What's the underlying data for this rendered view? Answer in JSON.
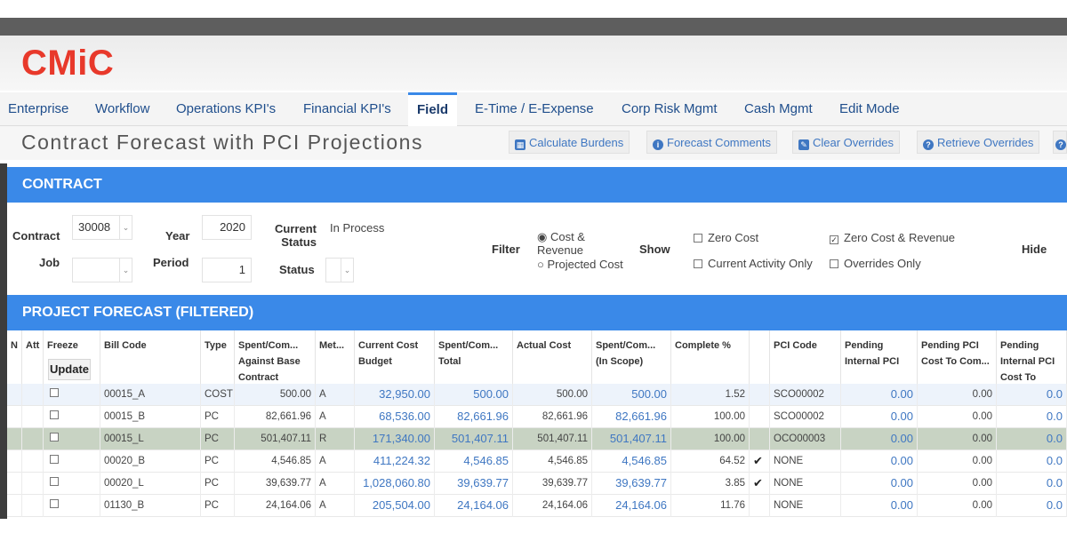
{
  "logo": {
    "text": "CMiC"
  },
  "nav": {
    "tabs": [
      {
        "label": "Enterprise"
      },
      {
        "label": "Workflow"
      },
      {
        "label": "Operations KPI's"
      },
      {
        "label": "Financial KPI's"
      },
      {
        "label": "Field",
        "active": true
      },
      {
        "label": "E-Time / E-Expense"
      },
      {
        "label": "Corp Risk Mgmt"
      },
      {
        "label": "Cash Mgmt"
      },
      {
        "label": "Edit Mode"
      }
    ]
  },
  "page": {
    "title": "Contract Forecast with PCI Projections"
  },
  "toolbar": {
    "calc_burdens": "Calculate Burdens",
    "forecast_comments": "Forecast Comments",
    "clear_overrides": "Clear Overrides",
    "retrieve_overrides": "Retrieve Overrides"
  },
  "contract_section": {
    "title": "CONTRACT",
    "contract_label": "Contract",
    "contract_value": "30008",
    "job_label": "Job",
    "year_label": "Year",
    "year_value": "2020",
    "period_label": "Period",
    "period_value": "1",
    "current_status_label": "Current Status",
    "current_status_value": "In Process",
    "status_label": "Status",
    "filter_label": "Filter",
    "filter_options": [
      "Cost & Revenue",
      "Projected Cost"
    ],
    "filter_selected": "Cost & Revenue",
    "show_label": "Show",
    "show_options": [
      {
        "label": "Zero Cost",
        "checked": false
      },
      {
        "label": "Current Activity Only",
        "checked": false
      },
      {
        "label": "Zero Cost & Revenue",
        "checked": true
      },
      {
        "label": "Overrides Only",
        "checked": false
      }
    ],
    "hide_label": "Hide"
  },
  "forecast_section": {
    "title": "PROJECT FORECAST (FILTERED)",
    "update_label": "Update",
    "columns": [
      "N",
      "Att",
      "Freeze",
      "Bill Code",
      "Type",
      "Spent/Com... Against Base Contract",
      "Met...",
      "Current Cost Budget",
      "Spent/Com... Total",
      "Actual Cost",
      "Spent/Com... (In Scope)",
      "Complete %",
      "",
      "PCI Code",
      "Pending Internal PCI",
      "Pending PCI Cost To Com...",
      "Pending Internal PCI Cost To Com..."
    ],
    "rows": [
      {
        "bill_code": "00015_A",
        "type": "COST",
        "spent_base": "500.00",
        "method": "A",
        "budget": "32,950.00",
        "spent_total": "500.00",
        "actual": "500.00",
        "spent_scope": "500.00",
        "complete": "1.52",
        "tick": "",
        "pci": "SCO00002",
        "pend_int": "0.00",
        "pend_ctc": "0.00",
        "pend_int_ctc": "0.0"
      },
      {
        "bill_code": "00015_B",
        "type": "PC",
        "spent_base": "82,661.96",
        "method": "A",
        "budget": "68,536.00",
        "spent_total": "82,661.96",
        "actual": "82,661.96",
        "spent_scope": "82,661.96",
        "complete": "100.00",
        "tick": "",
        "pci": "SCO00002",
        "pend_int": "0.00",
        "pend_ctc": "0.00",
        "pend_int_ctc": "0.0"
      },
      {
        "bill_code": "00015_L",
        "type": "PC",
        "spent_base": "501,407.11",
        "method": "R",
        "budget": "171,340.00",
        "spent_total": "501,407.11",
        "actual": "501,407.11",
        "spent_scope": "501,407.11",
        "complete": "100.00",
        "tick": "",
        "pci": "OCO00003",
        "pend_int": "0.00",
        "pend_ctc": "0.00",
        "pend_int_ctc": "0.0"
      },
      {
        "bill_code": "00020_B",
        "type": "PC",
        "spent_base": "4,546.85",
        "method": "A",
        "budget": "411,224.32",
        "spent_total": "4,546.85",
        "actual": "4,546.85",
        "spent_scope": "4,546.85",
        "complete": "64.52",
        "tick": "✔",
        "pci": "NONE",
        "pend_int": "0.00",
        "pend_ctc": "0.00",
        "pend_int_ctc": "0.0"
      },
      {
        "bill_code": "00020_L",
        "type": "PC",
        "spent_base": "39,639.77",
        "method": "A",
        "budget": "1,028,060.80",
        "spent_total": "39,639.77",
        "actual": "39,639.77",
        "spent_scope": "39,639.77",
        "complete": "3.85",
        "tick": "✔",
        "pci": "NONE",
        "pend_int": "0.00",
        "pend_ctc": "0.00",
        "pend_int_ctc": "0.0"
      },
      {
        "bill_code": "01130_B",
        "type": "PC",
        "spent_base": "24,164.06",
        "method": "A",
        "budget": "205,504.00",
        "spent_total": "24,164.06",
        "actual": "24,164.06",
        "spent_scope": "24,164.06",
        "complete": "11.76",
        "tick": "",
        "pci": "NONE",
        "pend_int": "0.00",
        "pend_ctc": "0.00",
        "pend_int_ctc": "0.0"
      }
    ]
  },
  "colors": {
    "accent": "#3a89e8",
    "brand": "#e8392b",
    "link": "#3f77c2",
    "highlight_row": "#c8d3c3"
  }
}
